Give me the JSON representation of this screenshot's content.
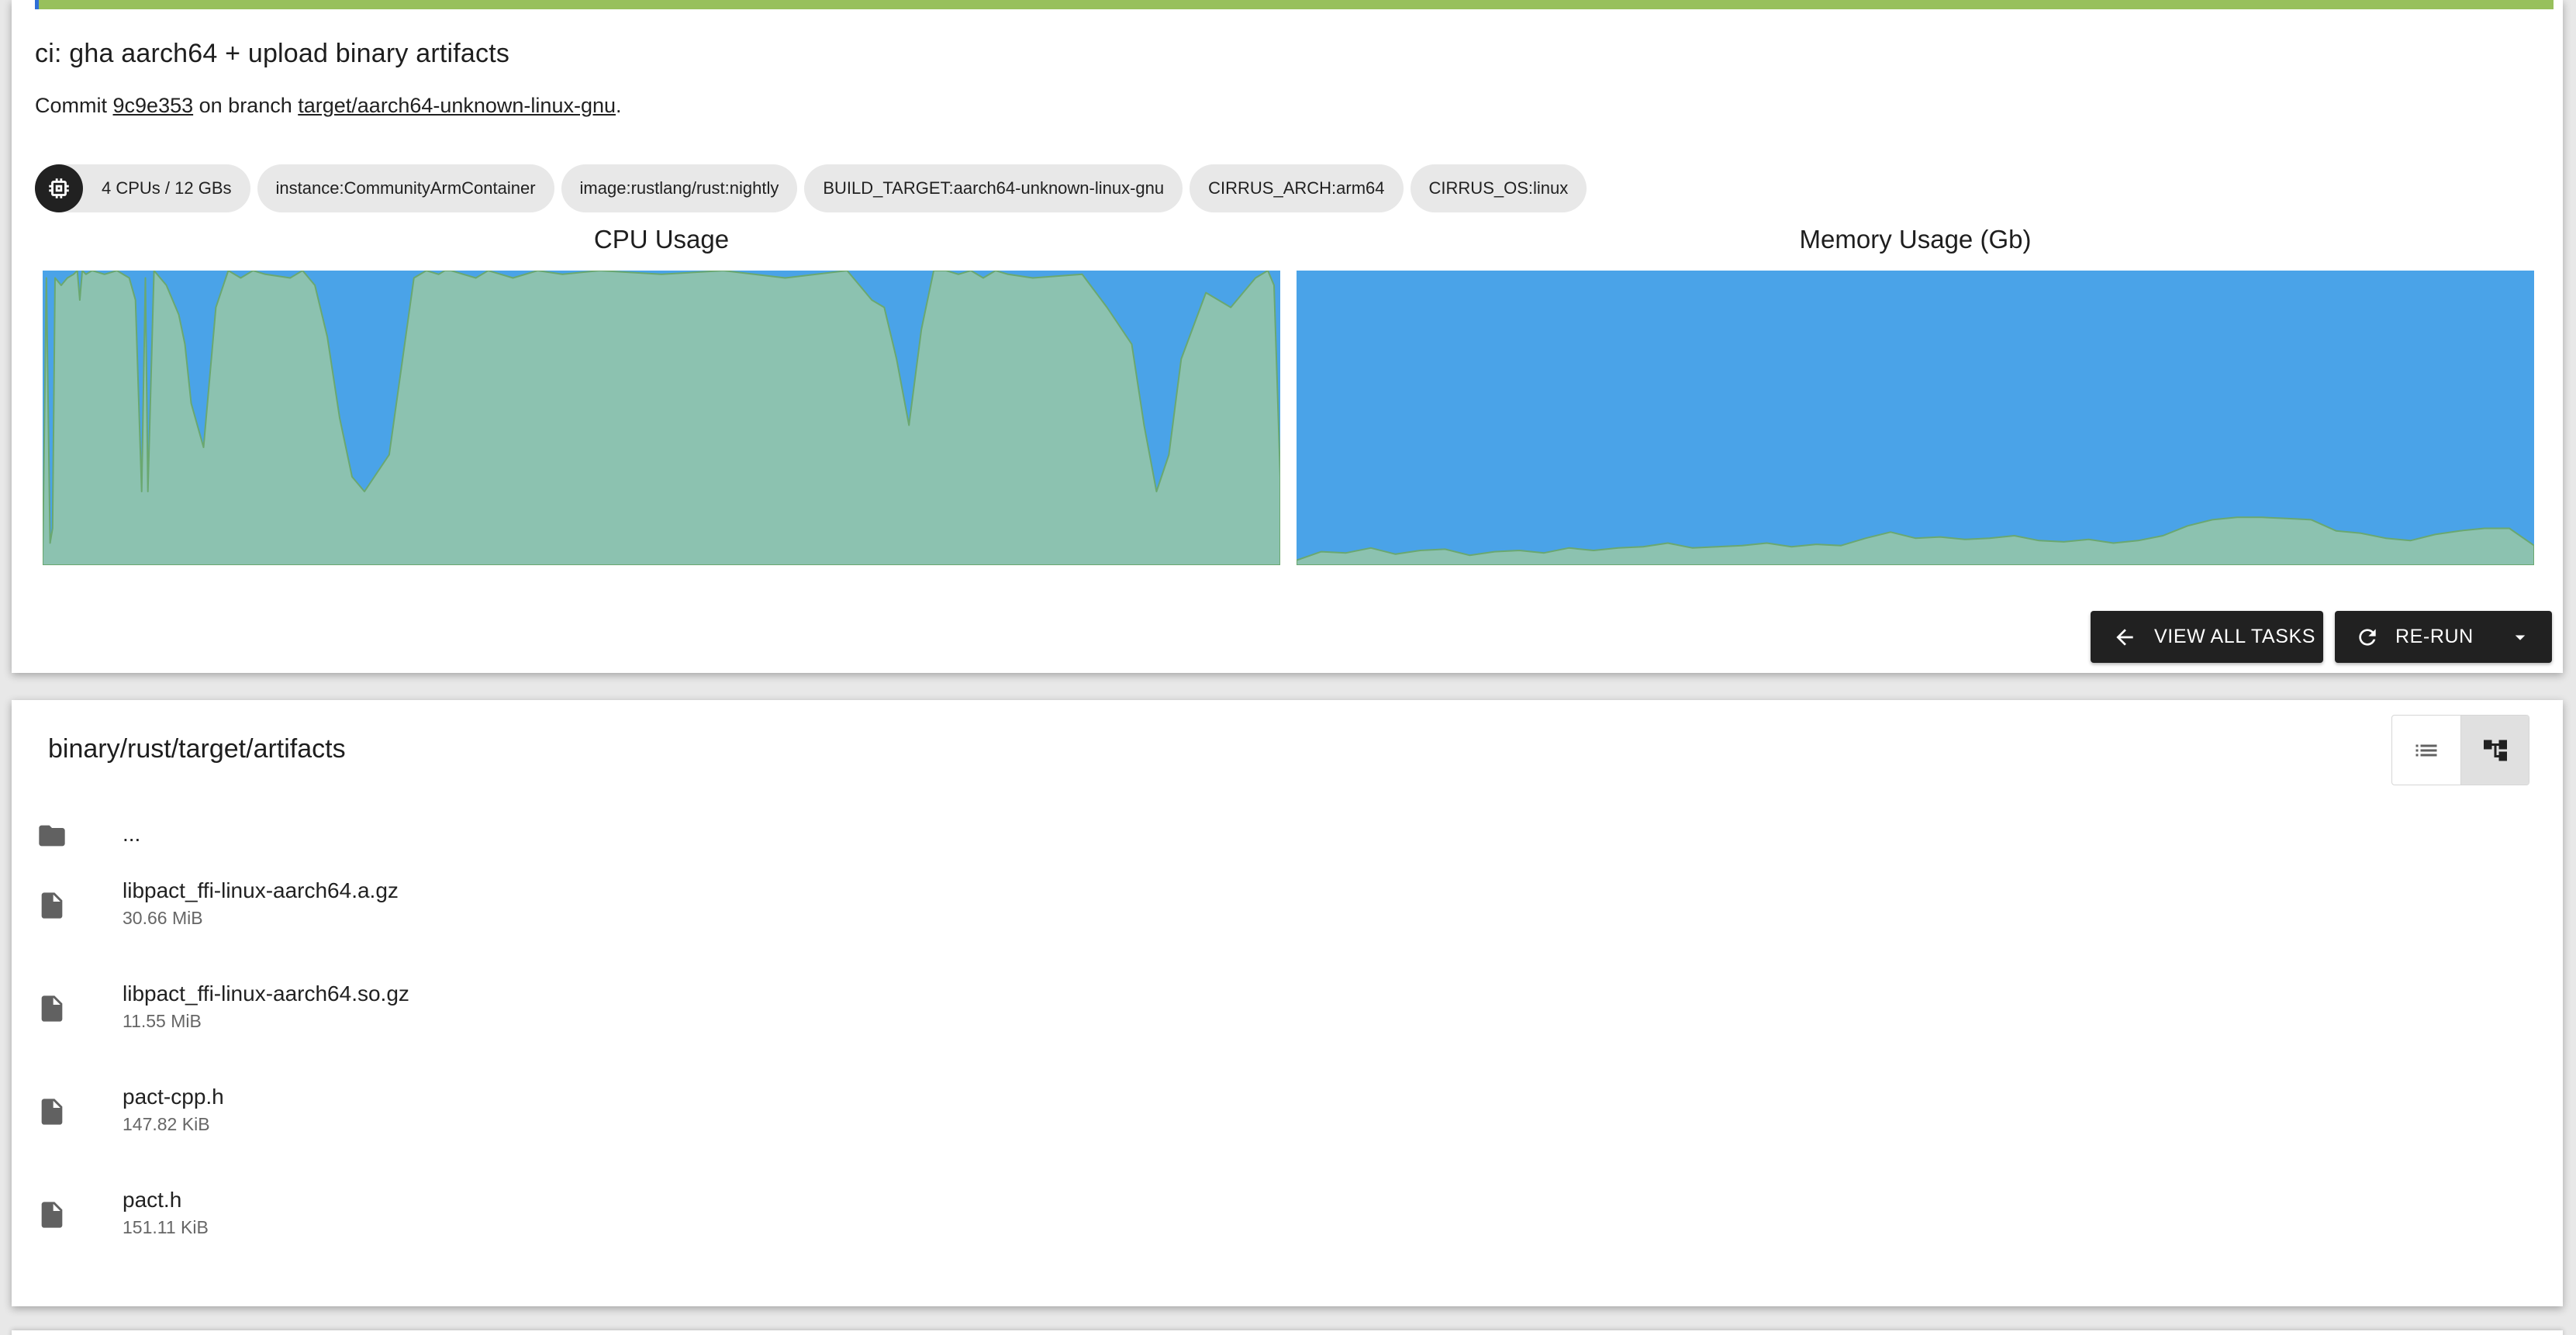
{
  "task": {
    "title": "ci: gha aarch64 + upload binary artifacts",
    "commit_prefix": "Commit",
    "commit_hash": "9c9e353",
    "branch_prefix": "on branch",
    "branch": "target/aarch64-unknown-linux-gnu",
    "branch_suffix": "."
  },
  "chips": [
    {
      "label": "4 CPUs / 12 GBs",
      "icon": "cpu-chip-icon"
    },
    {
      "label": "instance:CommunityArmContainer"
    },
    {
      "label": "image:rustlang/rust:nightly"
    },
    {
      "label": "BUILD_TARGET:aarch64-unknown-linux-gnu"
    },
    {
      "label": "CIRRUS_ARCH:arm64"
    },
    {
      "label": "CIRRUS_OS:linux"
    }
  ],
  "charts": {
    "cpu_title": "CPU Usage",
    "memory_title": "Memory Usage (Gb)"
  },
  "chart_data": [
    {
      "type": "area",
      "title": "CPU Usage",
      "ylim": [
        0,
        4
      ],
      "x": [
        0,
        0.3,
        0.6,
        0.8,
        1,
        1.5,
        2,
        2.5,
        2.8,
        3,
        3.2,
        3.5,
        4,
        5,
        6,
        7,
        7.5,
        8,
        8.3,
        8.5,
        9,
        10,
        11,
        11.5,
        12,
        13,
        14,
        15,
        16,
        17,
        18,
        20,
        21,
        22,
        23,
        24,
        25,
        26,
        28,
        30,
        31,
        32,
        32.5,
        33,
        34,
        35,
        36,
        38,
        40,
        42,
        45,
        50,
        55,
        60,
        65,
        66,
        67,
        68,
        69,
        70,
        71,
        72,
        73,
        74,
        75,
        76,
        77,
        78,
        80,
        84,
        86,
        88,
        89,
        90,
        91,
        92,
        94,
        96,
        97,
        98,
        99,
        99.5,
        100
      ],
      "values": [
        0.1,
        3.9,
        0.3,
        0.5,
        3.9,
        3.8,
        3.9,
        3.95,
        4,
        3.6,
        4,
        3.95,
        4,
        3.95,
        4,
        3.9,
        3.6,
        1,
        3.9,
        1,
        4,
        3.8,
        3.4,
        3,
        2.2,
        1.6,
        3.5,
        4,
        3.9,
        4,
        3.95,
        3.9,
        4,
        3.8,
        3.1,
        2,
        1.2,
        1,
        1.5,
        3.9,
        4,
        3.95,
        4,
        4,
        3.95,
        3.9,
        4,
        3.9,
        4,
        3.95,
        4,
        3.95,
        4,
        3.9,
        4,
        3.8,
        3.6,
        3.5,
        2.8,
        1.9,
        3.2,
        4,
        4,
        3.95,
        4,
        3.9,
        4,
        3.95,
        3.9,
        3.95,
        3.5,
        3,
        1.9,
        1,
        1.5,
        2.8,
        3.7,
        3.5,
        3.7,
        3.9,
        4,
        3.8,
        1.2
      ]
    },
    {
      "type": "area",
      "title": "Memory Usage (Gb)",
      "ylim": [
        0,
        12
      ],
      "x": [
        0,
        2,
        4,
        6,
        8,
        10,
        12,
        14,
        16,
        18,
        20,
        22,
        24,
        26,
        28,
        30,
        32,
        34,
        36,
        38,
        40,
        42,
        44,
        46,
        48,
        50,
        52,
        54,
        56,
        58,
        60,
        62,
        64,
        66,
        68,
        70,
        72,
        74,
        76,
        78,
        80,
        82,
        84,
        86,
        88,
        90,
        92,
        94,
        96,
        98,
        100
      ],
      "values": [
        0.2,
        0.55,
        0.5,
        0.7,
        0.45,
        0.6,
        0.65,
        0.4,
        0.55,
        0.6,
        0.5,
        0.7,
        0.6,
        0.7,
        0.75,
        0.9,
        0.7,
        0.75,
        0.8,
        0.9,
        0.75,
        0.85,
        0.8,
        1.1,
        1.35,
        1.1,
        1.15,
        1.05,
        1.1,
        1.2,
        1.0,
        0.95,
        1.05,
        0.9,
        1.0,
        1.2,
        1.6,
        1.85,
        1.95,
        1.95,
        1.9,
        1.85,
        1.4,
        1.3,
        1.1,
        1.0,
        1.25,
        1.4,
        1.5,
        1.5,
        0.8
      ]
    }
  ],
  "actions": {
    "view_all": "VIEW ALL TASKS",
    "rerun": "RE-RUN"
  },
  "artifacts": {
    "path": "binary/rust/target/artifacts",
    "parent": "...",
    "files": [
      {
        "name": "libpact_ffi-linux-aarch64.a.gz",
        "size": "30.66 MiB"
      },
      {
        "name": "libpact_ffi-linux-aarch64.so.gz",
        "size": "11.55 MiB"
      },
      {
        "name": "pact-cpp.h",
        "size": "147.82 KiB"
      },
      {
        "name": "pact.h",
        "size": "151.11 KiB"
      }
    ]
  },
  "colors": {
    "status": "#98c05c",
    "cpu_fill": "#8cc2b0",
    "background_fill": "#4aa3e8",
    "line": "#6aa870",
    "button": "#212121"
  }
}
